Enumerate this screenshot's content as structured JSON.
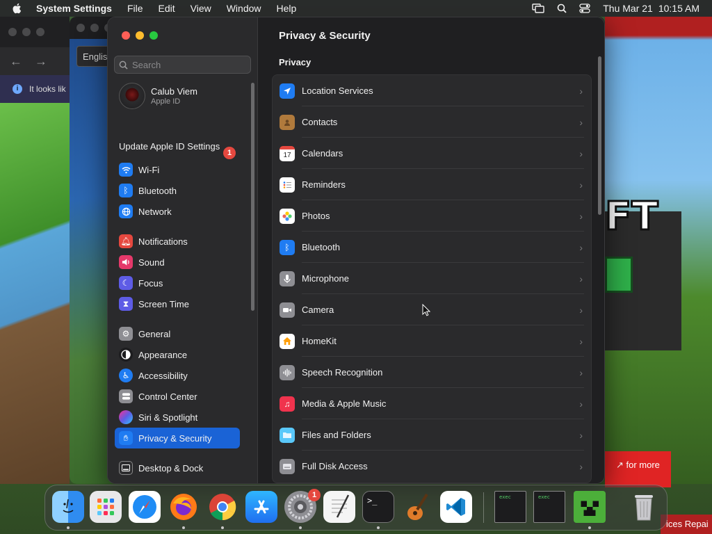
{
  "menubar": {
    "app_name": "System Settings",
    "menus": [
      "File",
      "Edit",
      "View",
      "Window",
      "Help"
    ],
    "date": "Thu Mar 21",
    "time": "10:15 AM"
  },
  "background": {
    "browser_lang": "Englis",
    "browser_info": "It looks lik",
    "right_promo": "for more",
    "bottom_text": "ices Repai",
    "game_logo": "FT"
  },
  "window": {
    "search_placeholder": "Search",
    "profile": {
      "name": "Calub Viem",
      "subtitle": "Apple ID"
    },
    "update": {
      "label": "Update Apple ID Settings",
      "badge": "1"
    },
    "sidebar": [
      {
        "label": "Wi-Fi",
        "icon": "wifi-icon",
        "color": "#1f7cf2"
      },
      {
        "label": "Bluetooth",
        "icon": "bluetooth-icon",
        "color": "#1f7cf2"
      },
      {
        "label": "Network",
        "icon": "globe-icon",
        "color": "#1f7cf2"
      },
      {
        "label": "Notifications",
        "icon": "bell-icon",
        "color": "#e5483f"
      },
      {
        "label": "Sound",
        "icon": "speaker-icon",
        "color": "#e5396a"
      },
      {
        "label": "Focus",
        "icon": "moon-icon",
        "color": "#5e5ce6"
      },
      {
        "label": "Screen Time",
        "icon": "hourglass-icon",
        "color": "#5e5ce6"
      },
      {
        "label": "General",
        "icon": "gear-icon",
        "color": "#8e8e93"
      },
      {
        "label": "Appearance",
        "icon": "appearance-icon",
        "color": "#1c1c1e"
      },
      {
        "label": "Accessibility",
        "icon": "accessibility-icon",
        "color": "#1f7cf2"
      },
      {
        "label": "Control Center",
        "icon": "toggle-icon",
        "color": "#8e8e93"
      },
      {
        "label": "Siri & Spotlight",
        "icon": "siri-icon",
        "color": "#9b4dca"
      },
      {
        "label": "Privacy & Security",
        "icon": "hand-icon",
        "color": "#1f7cf2",
        "selected": true
      },
      {
        "label": "Desktop & Dock",
        "icon": "dock-icon",
        "color": "#2c2c2e"
      }
    ],
    "content_title": "Privacy & Security",
    "section_title": "Privacy",
    "privacy_items": [
      {
        "label": "Location Services",
        "icon": "location-arrow-icon",
        "color": "#1f7cf2"
      },
      {
        "label": "Contacts",
        "icon": "contacts-icon",
        "color": "#b07a3c"
      },
      {
        "label": "Calendars",
        "icon": "calendar-icon",
        "color": "#ffffff",
        "text": "17"
      },
      {
        "label": "Reminders",
        "icon": "reminders-icon",
        "color": "#ffffff"
      },
      {
        "label": "Photos",
        "icon": "photos-icon",
        "color": "#ffffff"
      },
      {
        "label": "Bluetooth",
        "icon": "bluetooth-icon",
        "color": "#1f7cf2"
      },
      {
        "label": "Microphone",
        "icon": "microphone-icon",
        "color": "#8e8e93"
      },
      {
        "label": "Camera",
        "icon": "camera-icon",
        "color": "#8e8e93"
      },
      {
        "label": "HomeKit",
        "icon": "home-icon",
        "color": "#ffffff"
      },
      {
        "label": "Speech Recognition",
        "icon": "waveform-icon",
        "color": "#8e8e93"
      },
      {
        "label": "Media & Apple Music",
        "icon": "music-note-icon",
        "color": "#f0334d"
      },
      {
        "label": "Files and Folders",
        "icon": "folder-icon",
        "color": "#5ac8fa"
      },
      {
        "label": "Full Disk Access",
        "icon": "disk-icon",
        "color": "#8e8e93"
      }
    ]
  },
  "dock": {
    "system_settings_badge": "1",
    "apps": [
      {
        "name": "finder-icon",
        "color": "#2f8cf0",
        "running": true
      },
      {
        "name": "launchpad-icon",
        "color": "#e8e8ea",
        "running": false
      },
      {
        "name": "safari-icon",
        "color": "#ffffff",
        "running": false
      },
      {
        "name": "firefox-icon",
        "color": "#ff7a18",
        "running": true
      },
      {
        "name": "chrome-icon",
        "color": "#ffffff",
        "running": true
      },
      {
        "name": "app-store-icon",
        "color": "#1f8cf5",
        "running": false
      },
      {
        "name": "system-settings-icon",
        "color": "#8e8e93",
        "running": true
      },
      {
        "name": "textedit-icon",
        "color": "#f5f5f5",
        "running": false
      },
      {
        "name": "terminal-icon",
        "color": "#1c1c1e",
        "running": true
      },
      {
        "name": "garageband-icon",
        "color": "#e07b2a",
        "running": false
      },
      {
        "name": "vscode-icon",
        "color": "#ffffff",
        "running": false
      },
      {
        "name": "exec-window-1-icon",
        "color": "#1c1c1e",
        "running": false
      },
      {
        "name": "exec-window-2-icon",
        "color": "#1c1c1e",
        "running": false
      },
      {
        "name": "minecraft-icon",
        "color": "#4caf3a",
        "running": true
      },
      {
        "name": "trash-icon",
        "color": "#c8c8cc",
        "running": false
      }
    ]
  }
}
